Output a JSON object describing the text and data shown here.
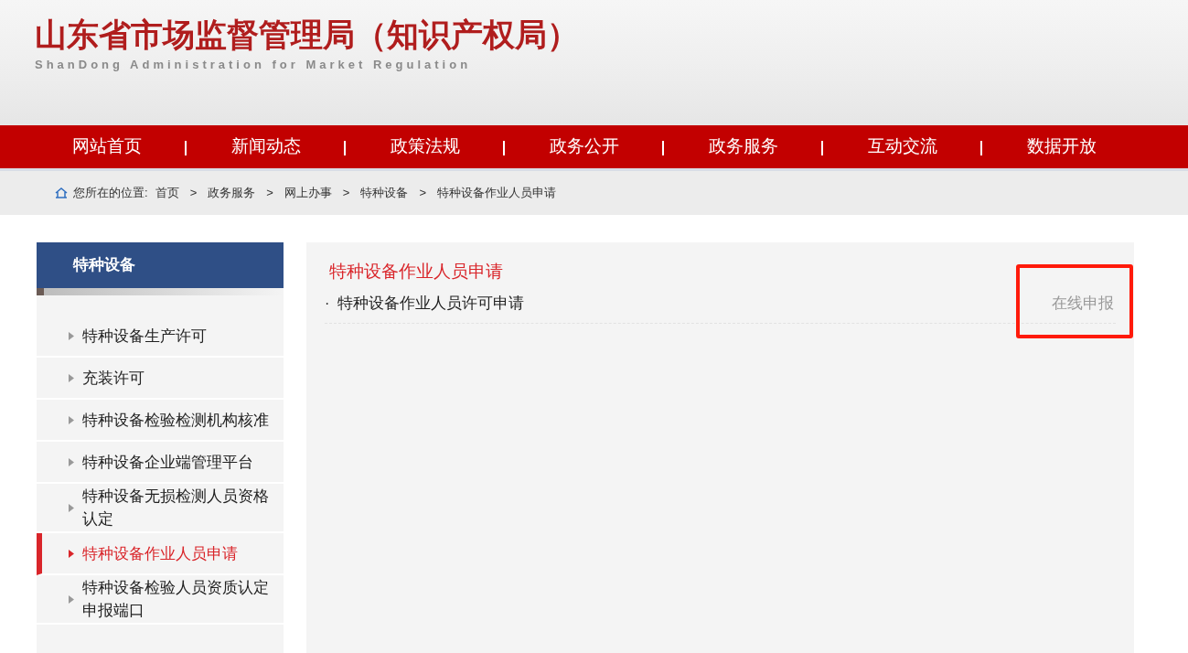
{
  "header": {
    "title": "山东省市场监督管理局（知识产权局）",
    "subtitle": "ShanDong Administration for Market Regulation"
  },
  "nav": [
    "网站首页",
    "新闻动态",
    "政策法规",
    "政务公开",
    "政务服务",
    "互动交流",
    "数据开放"
  ],
  "breadcrumb": {
    "label": "您所在的位置:",
    "items": [
      "首页",
      "政务服务",
      "网上办事",
      "特种设备",
      "特种设备作业人员申请"
    ],
    "separators": [
      ">",
      ">",
      ">",
      ">"
    ]
  },
  "sidebar": {
    "title": "特种设备",
    "items": [
      {
        "label": "特种设备生产许可",
        "selected": false
      },
      {
        "label": "充装许可",
        "selected": false
      },
      {
        "label": "特种设备检验检测机构核准",
        "selected": false
      },
      {
        "label": "特种设备企业端管理平台",
        "selected": false
      },
      {
        "label": "特种设备无损检测人员资格认定",
        "selected": false
      },
      {
        "label": "特种设备作业人员申请",
        "selected": true
      },
      {
        "label": "特种设备检验人员资质认定申报端口",
        "selected": false
      }
    ]
  },
  "content": {
    "title": "特种设备作业人员申请",
    "rows": [
      {
        "bullet": "·",
        "label": "特种设备作业人员许可申请",
        "action": "在线申报",
        "highlighted": true
      }
    ]
  }
}
